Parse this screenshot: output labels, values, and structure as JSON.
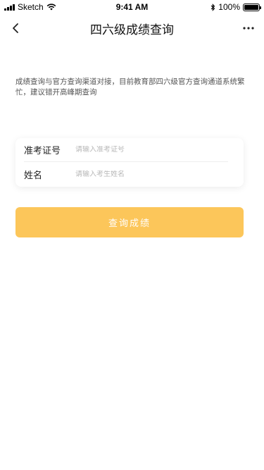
{
  "status_bar": {
    "carrier": "Sketch",
    "time": "9:41 AM",
    "battery": "100%"
  },
  "nav": {
    "title": "四六级成绩查询"
  },
  "notice": {
    "text": "成绩查询与官方查询渠道对接，目前教育部四六级官方查询通道系统繁忙，建议错开高峰期查询"
  },
  "form": {
    "exam_id_label": "准考证号",
    "exam_id_placeholder": "请输入准考证号",
    "name_label": "姓名",
    "name_placeholder": "请输入考生姓名"
  },
  "submit": {
    "label": "查询成绩"
  },
  "colors": {
    "accent": "#fcc65a"
  }
}
